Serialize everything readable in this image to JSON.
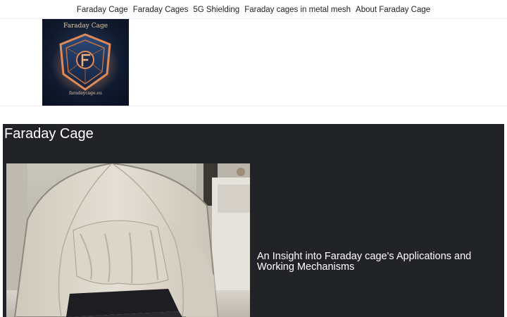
{
  "nav": {
    "items": [
      {
        "label": "Faraday Cage"
      },
      {
        "label": "Faraday Cages"
      },
      {
        "label": "5G Shielding"
      },
      {
        "label": "Faraday cages in metal mesh"
      },
      {
        "label": "About Faraday Cage"
      }
    ]
  },
  "logo": {
    "title": "Faraday Cage",
    "subtitle": "faradaycage.eu",
    "icon": "shield-f-icon"
  },
  "hero": {
    "title": "Faraday Cage",
    "description": "An Insight into Faraday cage's Applications and Working Mechanisms",
    "image": "faraday-tent-photo"
  },
  "colors": {
    "hero_bg": "#222327",
    "logo_bg": "#101a2e",
    "logo_accent": "#e08a55",
    "logo_text": "#e3c9a8"
  }
}
